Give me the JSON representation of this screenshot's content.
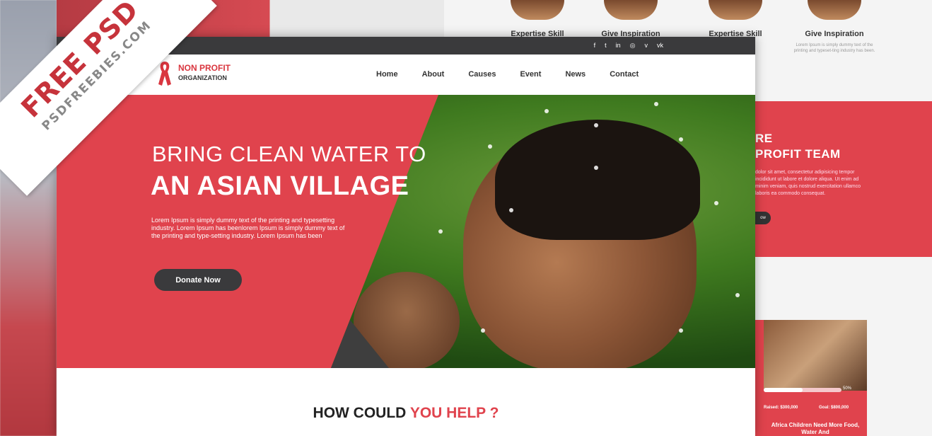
{
  "badge": {
    "line1": "FREE PSD",
    "line2": "PSDFREEBIES.COM"
  },
  "background": {
    "skills": [
      {
        "title": "Expertise Skill",
        "desc": ""
      },
      {
        "title": "Give Inspiration",
        "desc": ""
      },
      {
        "title": "Expertise Skill",
        "desc": ""
      },
      {
        "title": "Give Inspiration",
        "desc": "Lorem Ipsum is simply dummy text of the printing and typeset-ting industry has been."
      }
    ],
    "team": {
      "line1": "RE",
      "line2": "PROFIT TEAM",
      "desc": "dolor sit amet, consectetur adipisicing tempor incididunt ut labore et dolore aliqua. Ut enim ad minim veniam, quis nostrud exercitation ullamco laboris ea commodo consequat.",
      "btn": "ow"
    },
    "cause": {
      "progress": 50,
      "pct_label": "50%",
      "raised": "Raised: $300,000",
      "goal": "Goal: $800,000",
      "title": "Africa Children Need More Food, Water And"
    }
  },
  "site": {
    "social": [
      "f",
      "t",
      "in",
      "◎",
      "v",
      "vk"
    ],
    "logo": {
      "line1": "NON PROFIT",
      "line2": "ORGANIZATION"
    },
    "nav": [
      "Home",
      "About",
      "Causes",
      "Event",
      "News",
      "Contact"
    ],
    "hero": {
      "title1": "BRING CLEAN WATER TO",
      "title2": "AN ASIAN VILLAGE",
      "text": "Lorem Ipsum is simply dummy text of the printing and typesetting industry. Lorem Ipsum has beenlorem Ipsum is simply dummy text of the printing and type-setting industry. Lorem Ipsum has been",
      "button": "Donate Now"
    },
    "help": {
      "part1": "HOW COULD ",
      "part2": "YOU HELP ?"
    }
  },
  "colors": {
    "accent": "#e0434d",
    "dark": "#3a3a3c"
  }
}
